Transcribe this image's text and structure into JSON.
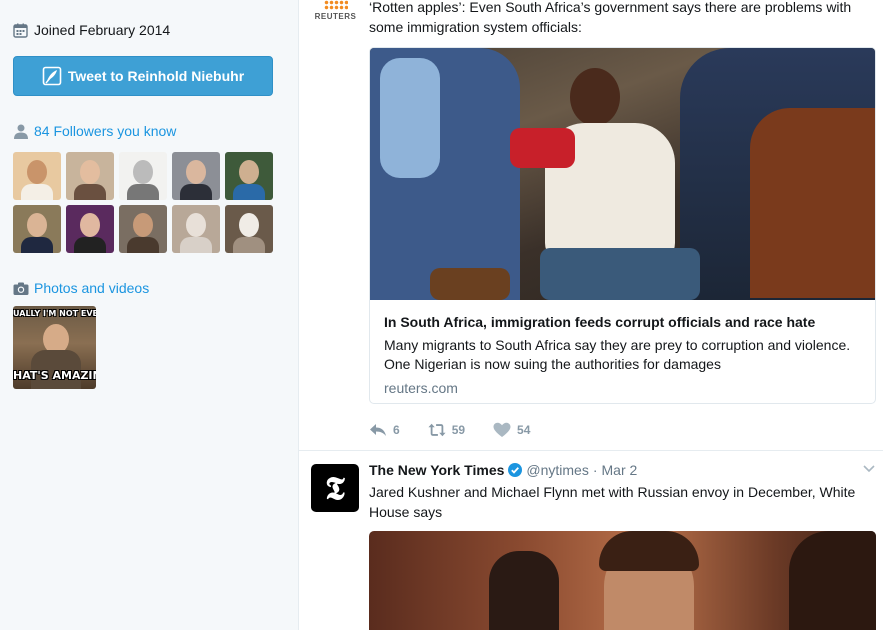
{
  "sidebar": {
    "joined": "Joined February 2014",
    "tweet_button": "Tweet to Reinhold Niebuhr",
    "followers_link": "84 Followers you know",
    "photos_link": "Photos and videos",
    "media_top_text": "UALLY I'M NOT EVEN",
    "media_bottom_text": "HAT'S AMAZIN"
  },
  "tweet1": {
    "logo": "REUTERS",
    "text": "‘Rotten apples’: Even South Africa’s government says there are problems with some immigration system officials:",
    "card": {
      "title": "In South Africa, immigration feeds corrupt officials and race hate",
      "description": "Many migrants to South Africa say they are prey to corruption and violence. One Nigerian is now suing the authorities for damages",
      "domain": "reuters.com"
    },
    "replies": "6",
    "retweets": "59",
    "likes": "54"
  },
  "tweet2": {
    "avatar_glyph": "𝕿",
    "name": "The New York Times",
    "handle": "@nytimes",
    "separator": "·",
    "date": "Mar 2",
    "text": "Jared Kushner and Michael Flynn met with Russian envoy in December, White House says"
  },
  "colors": {
    "accent": "#1b95e0",
    "button": "#3ea0d5",
    "muted": "#657786",
    "icon_gray": "#8899a6"
  },
  "icons": [
    "calendar-icon",
    "feather-icon",
    "person-icon",
    "camera-icon",
    "reply-icon",
    "retweet-icon",
    "heart-icon",
    "verified-icon",
    "chevron-down-icon"
  ]
}
